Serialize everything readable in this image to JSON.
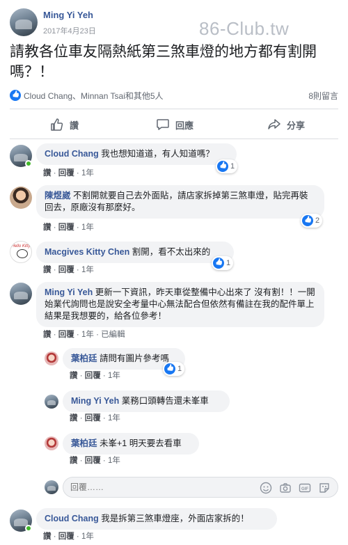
{
  "post": {
    "author": "Ming Yi Yeh",
    "date": "2017年4月23日",
    "watermark": "86-Club.tw",
    "text": "請教各位車友隔熱紙第三煞車燈的地方都有割開嗎？！",
    "reactors": "Cloud Chang、Minnan Tsai和其他5人",
    "comment_count": "8則留言"
  },
  "actions": {
    "like": "讚",
    "comment": "回應",
    "share": "分享"
  },
  "meta_labels": {
    "like": "讚",
    "reply": "回覆",
    "edit": "已編輯"
  },
  "comments": [
    {
      "name": "Cloud Chang",
      "text": "我也想知道道，有人知道嗎？",
      "time": "1年",
      "reactions": "1"
    },
    {
      "name": "陳煜崴",
      "text": "不割開就要自己去外面貼，請店家拆掉第三煞車燈，貼完再裝回去，原廠沒有那麼好。",
      "time": "1年",
      "reactions": "2"
    },
    {
      "name": "Macgives Kitty Chen",
      "text": "割開，看不太出來的",
      "time": "1年",
      "reactions": "1"
    },
    {
      "name": "Ming Yi Yeh",
      "text": "更新一下資訊，昨天車從整備中心出來了 沒有割！！一開始業代詢問也是說安全考量中心無法配合但依然有備註在我的配件單上結果是我想要的，給各位參考！",
      "time": "1年"
    },
    {
      "name": "Cloud Chang",
      "text": "我是拆第三煞車燈座，外面店家拆的！",
      "time": "1年"
    }
  ],
  "replies": [
    {
      "name": "葉柏廷",
      "text": "請問有圖片參考嗎",
      "time": "1年",
      "reactions": "1"
    },
    {
      "name": "Ming Yi Yeh",
      "text": "業務口頭轉告還未峯車",
      "time": "1年"
    },
    {
      "name": "葉柏廷",
      "text": "未峯+1 明天要去看車",
      "time": "1年"
    }
  ],
  "reply_box": {
    "placeholder": "回覆……"
  },
  "icons": [
    "like-icon",
    "comment-icon",
    "share-icon",
    "emoji-icon",
    "camera-icon",
    "gif-icon",
    "sticker-icon"
  ],
  "colors": {
    "name_link": "#385898",
    "like_blue": "#1877f2",
    "bubble_bg": "#f2f3f5",
    "online_green": "#42b72a"
  }
}
